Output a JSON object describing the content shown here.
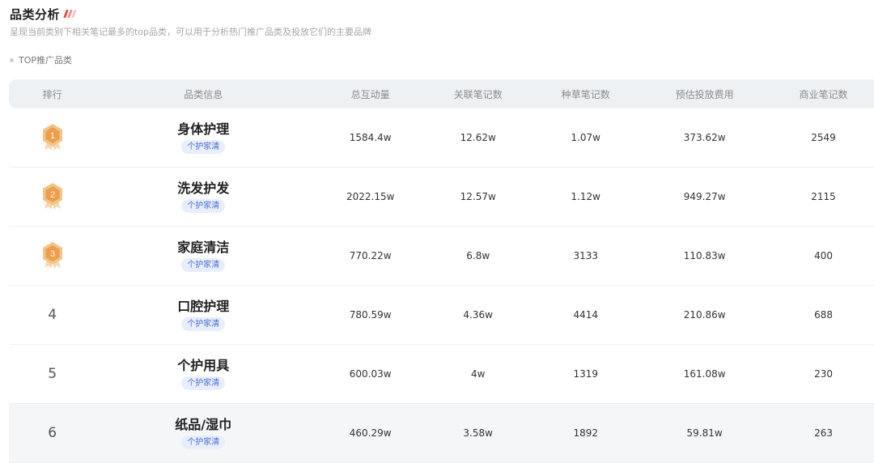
{
  "header": {
    "title": "品类分析",
    "subtitle": "呈现当前类别下相关笔记最多的top品类，可以用于分析热门推广品类及投放它们的主要品牌",
    "accent_colors": [
      "#e8474c",
      "#f58a8c",
      "#f6c1c2"
    ]
  },
  "section": {
    "label": "TOP推广品类"
  },
  "table": {
    "columns": [
      "排行",
      "品类信息",
      "总互动量",
      "关联笔记数",
      "种草笔记数",
      "预估投放费用",
      "商业笔记数"
    ],
    "rows": [
      {
        "rank": "1",
        "medal": true,
        "name": "身体护理",
        "tag": "个护家清",
        "total": "1584.4w",
        "related": "12.62w",
        "seed": "1.07w",
        "cost": "373.62w",
        "biz": "2549"
      },
      {
        "rank": "2",
        "medal": true,
        "name": "洗发护发",
        "tag": "个护家清",
        "total": "2022.15w",
        "related": "12.57w",
        "seed": "1.12w",
        "cost": "949.27w",
        "biz": "2115"
      },
      {
        "rank": "3",
        "medal": true,
        "name": "家庭清洁",
        "tag": "个护家清",
        "total": "770.22w",
        "related": "6.8w",
        "seed": "3133",
        "cost": "110.83w",
        "biz": "400"
      },
      {
        "rank": "4",
        "medal": false,
        "name": "口腔护理",
        "tag": "个护家清",
        "total": "780.59w",
        "related": "4.36w",
        "seed": "4414",
        "cost": "210.86w",
        "biz": "688"
      },
      {
        "rank": "5",
        "medal": false,
        "name": "个护用具",
        "tag": "个护家清",
        "total": "600.03w",
        "related": "4w",
        "seed": "1319",
        "cost": "161.08w",
        "biz": "230"
      },
      {
        "rank": "6",
        "medal": false,
        "name": "纸品/湿巾",
        "tag": "个护家清",
        "total": "460.29w",
        "related": "3.58w",
        "seed": "1892",
        "cost": "59.81w",
        "biz": "263"
      }
    ]
  },
  "medal_colors": {
    "outer": "#f3c488",
    "inner": "#ed9e4c",
    "ribbon": "#f7d7ad",
    "text": "#fff4e3"
  }
}
